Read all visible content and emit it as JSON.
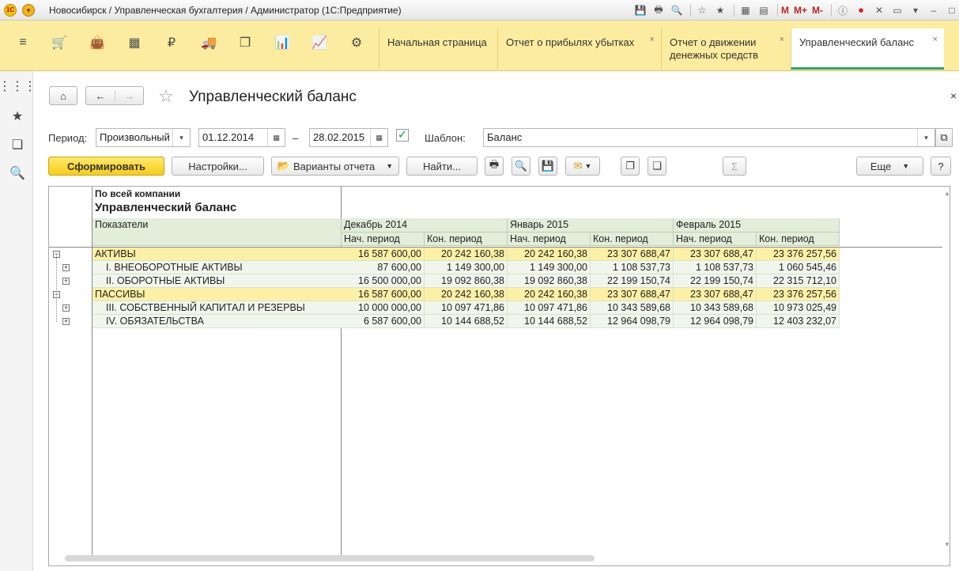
{
  "window": {
    "title": "Новосибирск / Управленческая бухгалтерия / Администратор  (1С:Предприятие)",
    "logo_text": "1С",
    "menu_glyph": "▾",
    "tool_m": "M",
    "tool_mplus": "M+",
    "tool_mminus": "M-"
  },
  "tabs": [
    {
      "label": "Начальная страница"
    },
    {
      "label": "Отчет о прибылях убытках"
    },
    {
      "label": "Отчет о движении денежных средств"
    },
    {
      "label": "Управленческий баланс"
    }
  ],
  "report_form": {
    "title": "Управленческий баланс",
    "period_label": "Период:",
    "period_type": "Произвольный",
    "date_from": "01.12.2014",
    "dash": "–",
    "date_to": "28.02.2015",
    "template_label": "Шаблон:",
    "template_value": "Баланс",
    "generate_label": "Сформировать",
    "settings_label": "Настройки...",
    "variants_label": "Варианты отчета",
    "find_label": "Найти...",
    "more_label": "Еще",
    "help_label": "?",
    "close_glyph": "×"
  },
  "report": {
    "company": "По всей компании",
    "title": "Управленческий баланс",
    "indicators_label": "Показатели",
    "months": [
      "Декабрь 2014",
      "Январь 2015",
      "Февраль 2015"
    ],
    "start_label": "Нач. период",
    "end_label": "Кон. период",
    "rows": [
      {
        "name": "АКТИВЫ",
        "group": true,
        "values": [
          "16 587 600,00",
          "20 242 160,38",
          "20 242 160,38",
          "23 307 688,47",
          "23 307 688,47",
          "23 376 257,56"
        ]
      },
      {
        "name": "I. ВНЕОБОРОТНЫЕ АКТИВЫ",
        "group": false,
        "values": [
          "87 600,00",
          "1 149 300,00",
          "1 149 300,00",
          "1 108 537,73",
          "1 108 537,73",
          "1 060 545,46"
        ]
      },
      {
        "name": "II. ОБОРОТНЫЕ АКТИВЫ",
        "group": false,
        "values": [
          "16 500 000,00",
          "19 092 860,38",
          "19 092 860,38",
          "22 199 150,74",
          "22 199 150,74",
          "22 315 712,10"
        ]
      },
      {
        "name": "ПАССИВЫ",
        "group": true,
        "values": [
          "16 587 600,00",
          "20 242 160,38",
          "20 242 160,38",
          "23 307 688,47",
          "23 307 688,47",
          "23 376 257,56"
        ]
      },
      {
        "name": "III. СОБСТВЕННЫЙ КАПИТАЛ И РЕЗЕРВЫ",
        "group": false,
        "values": [
          "10 000 000,00",
          "10 097 471,86",
          "10 097 471,86",
          "10 343 589,68",
          "10 343 589,68",
          "10 973 025,49"
        ]
      },
      {
        "name": "IV. ОБЯЗАТЕЛЬСТВА",
        "group": false,
        "values": [
          "6 587 600,00",
          "10 144 688,52",
          "10 144 688,52",
          "12 964 098,79",
          "12 964 098,79",
          "12 403 232,07"
        ]
      }
    ]
  },
  "colors": {
    "toolbar": "#fbec9f",
    "primary_button": "#f7cc1a",
    "group_row": "#fbf0a4",
    "header_cell": "#e2edda",
    "active_tab_underline": "#2ea56a"
  }
}
